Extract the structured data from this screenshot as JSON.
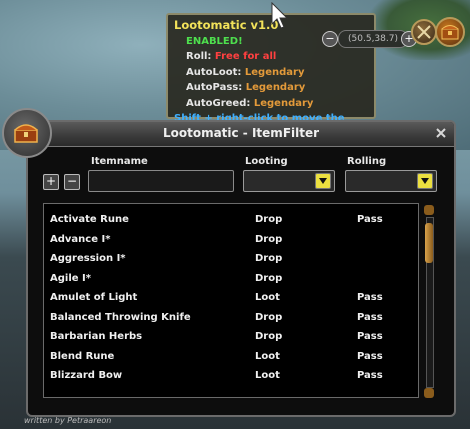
{
  "tooltip": {
    "title": "Lootomatic v1.0",
    "status": "ENABLED!",
    "roll_label": "Roll:",
    "roll_value": "Free for all",
    "autoloot_label": "AutoLoot:",
    "autoloot_value": "Legendary",
    "autopass_label": "AutoPass:",
    "autopass_value": "Legendary",
    "autogreed_label": "AutoGreed:",
    "autogreed_value": "Legendary",
    "hint": "Shift + right-click to move the buttons."
  },
  "minimap": {
    "coords": "(50.5,38.7)",
    "zoom_in": "+",
    "zoom_out": "−"
  },
  "window": {
    "title": "Lootomatic - ItemFilter",
    "columns": {
      "itemname": "Itemname",
      "looting": "Looting",
      "rolling": "Rolling"
    },
    "add_label": "+",
    "remove_label": "−",
    "itemname_value": "",
    "looting_selected": "",
    "rolling_selected": ""
  },
  "items": [
    {
      "name": "Activate Rune",
      "looting": "Drop",
      "rolling": "Pass"
    },
    {
      "name": "Advance I*",
      "looting": "Drop",
      "rolling": ""
    },
    {
      "name": "Aggression I*",
      "looting": "Drop",
      "rolling": ""
    },
    {
      "name": "Agile I*",
      "looting": "Drop",
      "rolling": ""
    },
    {
      "name": "Amulet of Light",
      "looting": "Loot",
      "rolling": "Pass"
    },
    {
      "name": "Balanced Throwing Knife",
      "looting": "Drop",
      "rolling": "Pass"
    },
    {
      "name": "Barbarian Herbs",
      "looting": "Drop",
      "rolling": "Pass"
    },
    {
      "name": "Blend Rune",
      "looting": "Loot",
      "rolling": "Pass"
    },
    {
      "name": "Blizzard Bow",
      "looting": "Loot",
      "rolling": "Pass"
    }
  ],
  "footer": {
    "credit": "written by Petraareon"
  },
  "colors": {
    "enabled": "#4ee04e",
    "roll_value": "#ff4040",
    "legendary": "#e39a3a",
    "hint": "#3fb0ff",
    "title": "#f2e25a",
    "dropdown_arrow": "#ece040"
  }
}
